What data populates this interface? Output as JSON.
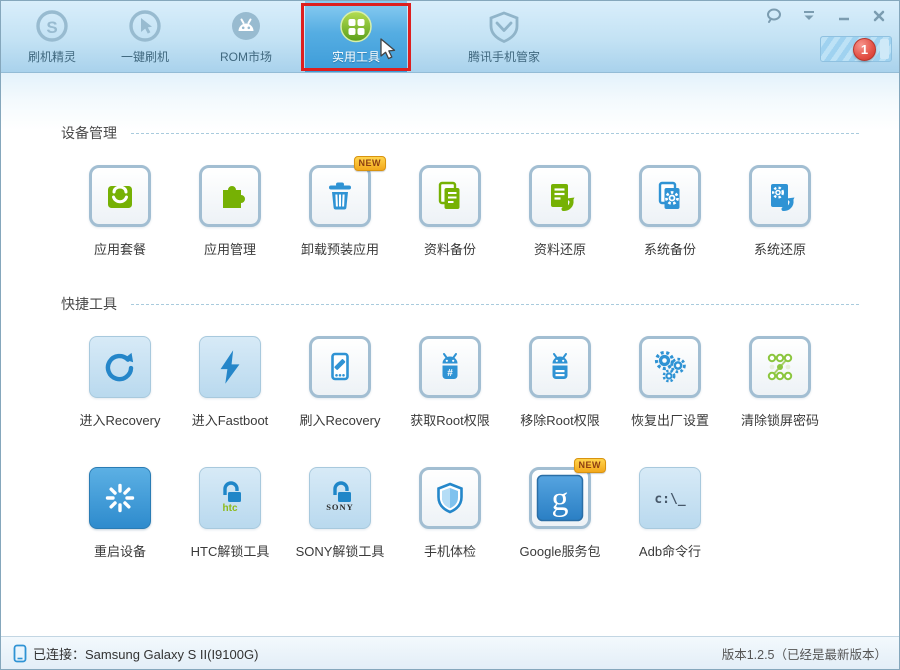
{
  "colors": {
    "active_tab_blue": "#44a3dd",
    "green_icon": "#76b104",
    "blue_icon": "#2f93d4",
    "new_badge_orange": "#f3a81c",
    "notification_red": "#e04038",
    "annotation_red": "#dd1f1f"
  },
  "header": {
    "tabs": [
      {
        "label": "刷机精灵",
        "icon": "shuaji-logo-icon",
        "active": false
      },
      {
        "label": "一键刷机",
        "icon": "one-key-flash-icon",
        "active": false
      },
      {
        "label": "ROM市场",
        "icon": "rom-market-icon",
        "active": false
      },
      {
        "label": "实用工具",
        "icon": "utility-tools-icon",
        "active": true,
        "annotated": true
      },
      {
        "label": "腾讯手机管家",
        "icon": "phone-manager-icon",
        "active": false
      }
    ],
    "window_controls": [
      "message-icon",
      "skin-icon",
      "minimize-icon",
      "close-icon"
    ],
    "notification_count": "1"
  },
  "sections": [
    {
      "title": "设备管理",
      "items": [
        {
          "label": "应用套餐",
          "icon": "app-bundle-icon"
        },
        {
          "label": "应用管理",
          "icon": "app-manage-icon"
        },
        {
          "label": "卸载预装应用",
          "icon": "uninstall-preinstalled-icon",
          "badge": "NEW"
        },
        {
          "label": "资料备份",
          "icon": "data-backup-icon"
        },
        {
          "label": "资料还原",
          "icon": "data-restore-icon"
        },
        {
          "label": "系统备份",
          "icon": "system-backup-icon"
        },
        {
          "label": "系统还原",
          "icon": "system-restore-icon"
        }
      ]
    },
    {
      "title": "快捷工具",
      "items": [
        {
          "label": "进入Recovery",
          "icon": "enter-recovery-icon"
        },
        {
          "label": "进入Fastboot",
          "icon": "enter-fastboot-icon"
        },
        {
          "label": "刷入Recovery",
          "icon": "flash-recovery-icon"
        },
        {
          "label": "获取Root权限",
          "icon": "get-root-icon"
        },
        {
          "label": "移除Root权限",
          "icon": "remove-root-icon"
        },
        {
          "label": "恢复出厂设置",
          "icon": "factory-reset-icon"
        },
        {
          "label": "清除锁屏密码",
          "icon": "clear-lockscreen-icon"
        },
        {
          "label": "重启设备",
          "icon": "reboot-device-icon"
        },
        {
          "label": "HTC解锁工具",
          "icon": "htc-unlock-icon",
          "icon_text": "htc"
        },
        {
          "label": "SONY解锁工具",
          "icon": "sony-unlock-icon",
          "icon_text": "SONY"
        },
        {
          "label": "手机体检",
          "icon": "phone-checkup-icon"
        },
        {
          "label": "Google服务包",
          "icon": "google-services-icon",
          "icon_text": "g",
          "badge": "NEW"
        },
        {
          "label": "Adb命令行",
          "icon": "adb-command-icon",
          "icon_text": "c:\\_"
        }
      ]
    }
  ],
  "status_bar": {
    "connection": "已连接：Samsung Galaxy S II(I9100G)",
    "version": "版本1.2.5（已经是最新版本）"
  }
}
